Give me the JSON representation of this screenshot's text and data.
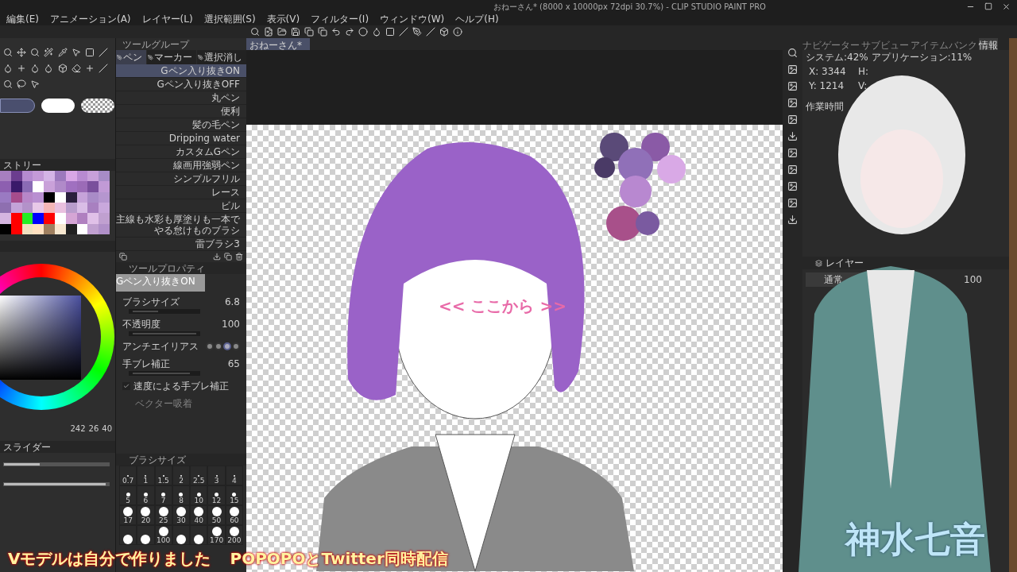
{
  "window": {
    "title": "おねーさん* (8000 x 10000px 72dpi 30.7%) - CLIP STUDIO PAINT PRO"
  },
  "menu": [
    "編集(E)",
    "アニメーション(A)",
    "レイヤー(L)",
    "選択範囲(S)",
    "表示(V)",
    "フィルター(I)",
    "ウィンドウ(W)",
    "ヘルプ(H)"
  ],
  "canvas_tab": {
    "label": "おねーさん*",
    "selected": true
  },
  "tool_group": {
    "title": "ツールグループ",
    "tabs": [
      {
        "label": "ペン",
        "selected": true
      },
      {
        "label": "マーカー",
        "selected": false
      },
      {
        "label": "選択消し",
        "selected": false
      }
    ],
    "brushes": [
      {
        "name": "Gペン入り抜きON",
        "selected": true
      },
      {
        "name": "Gペン入り抜きOFF",
        "selected": false
      },
      {
        "name": "丸ペン",
        "selected": false
      },
      {
        "name": "便利",
        "selected": false
      },
      {
        "name": "髪の毛ペン",
        "selected": false
      },
      {
        "name": "Dripping water",
        "selected": false
      },
      {
        "name": "カスタムGペン",
        "selected": false
      },
      {
        "name": "線画用強弱ペン",
        "selected": false
      },
      {
        "name": "シンプルフリル",
        "selected": false
      },
      {
        "name": "レース",
        "selected": false
      },
      {
        "name": "ビル",
        "selected": false
      },
      {
        "name": "主線も水彩も厚塗りも一本でやる怠けものブラシ",
        "selected": false
      },
      {
        "name": "雷ブラシ3",
        "selected": false
      }
    ]
  },
  "palette": {
    "title": "ストリー"
  },
  "tool_property": {
    "title": "ツールプロパティ",
    "preview": "Gペン入り抜きON",
    "rows": [
      {
        "kind": "slider",
        "label": "ブラシサイズ",
        "value": "6.8",
        "level": 0.4
      },
      {
        "kind": "slider",
        "label": "不透明度",
        "value": "100",
        "level": 1
      },
      {
        "kind": "antialias",
        "label": "アンチエイリアス",
        "options": [
          {
            "selected": false
          },
          {
            "selected": false
          },
          {
            "selected": true
          },
          {
            "selected": false
          }
        ]
      },
      {
        "kind": "slider",
        "label": "手ブレ補正",
        "value": "65",
        "level": 0.9
      },
      {
        "kind": "checkbox",
        "label": "速度による手ブレ補正",
        "checked": true
      },
      {
        "kind": "disabled",
        "label": "ベクター吸着"
      }
    ]
  },
  "color": {
    "values": [
      "242",
      "26",
      "40"
    ]
  },
  "slider_panel": {
    "title": "スライダー",
    "sliders": [
      {
        "level": 0.34
      },
      {
        "level": 0.97
      }
    ]
  },
  "brush_size": {
    "title": "ブラシサイズ",
    "rows": [
      {
        "kind": "tiny",
        "cells": [
          {
            "label": "0.7"
          },
          {
            "label": "1"
          },
          {
            "label": "1.5"
          },
          {
            "label": "2"
          },
          {
            "label": "2.5"
          },
          {
            "label": "3"
          },
          {
            "label": "4"
          }
        ]
      },
      {
        "kind": "small",
        "cells": [
          {
            "label": "5"
          },
          {
            "label": "6"
          },
          {
            "label": "7"
          },
          {
            "label": "8"
          },
          {
            "label": "10"
          },
          {
            "label": "12"
          },
          {
            "label": "15"
          }
        ]
      },
      {
        "kind": "large",
        "cells": [
          {
            "label": "17"
          },
          {
            "label": "20"
          },
          {
            "label": "25"
          },
          {
            "label": "30"
          },
          {
            "label": "40"
          },
          {
            "label": "50"
          },
          {
            "label": "60"
          }
        ]
      },
      {
        "kind": "large",
        "cells": [
          {},
          {},
          {
            "label": "100"
          },
          {},
          {},
          {
            "label": "170"
          },
          {
            "label": "200"
          }
        ]
      }
    ]
  },
  "info": {
    "tabs": [
      {
        "label": "ナビゲーター",
        "selected": false
      },
      {
        "label": "サブビュー",
        "selected": false
      },
      {
        "label": "アイテムバンク",
        "selected": false
      },
      {
        "label": "情報",
        "selected": true
      }
    ],
    "usage": "システム:42% アプリケーション:11%",
    "x": "X: 3344",
    "y": "Y: 1214",
    "h": "H:",
    "v": "V:",
    "work_time": "作業時間"
  },
  "layers": {
    "title": "レイヤー",
    "blend": "通常",
    "opacity": "100"
  },
  "overlay": {
    "canvas_text": "<< ここから >>",
    "caption_left": "Vモデルは自分で作りました",
    "caption_right": "POPOPOとTwitter同時配信",
    "name": "神水七音"
  }
}
